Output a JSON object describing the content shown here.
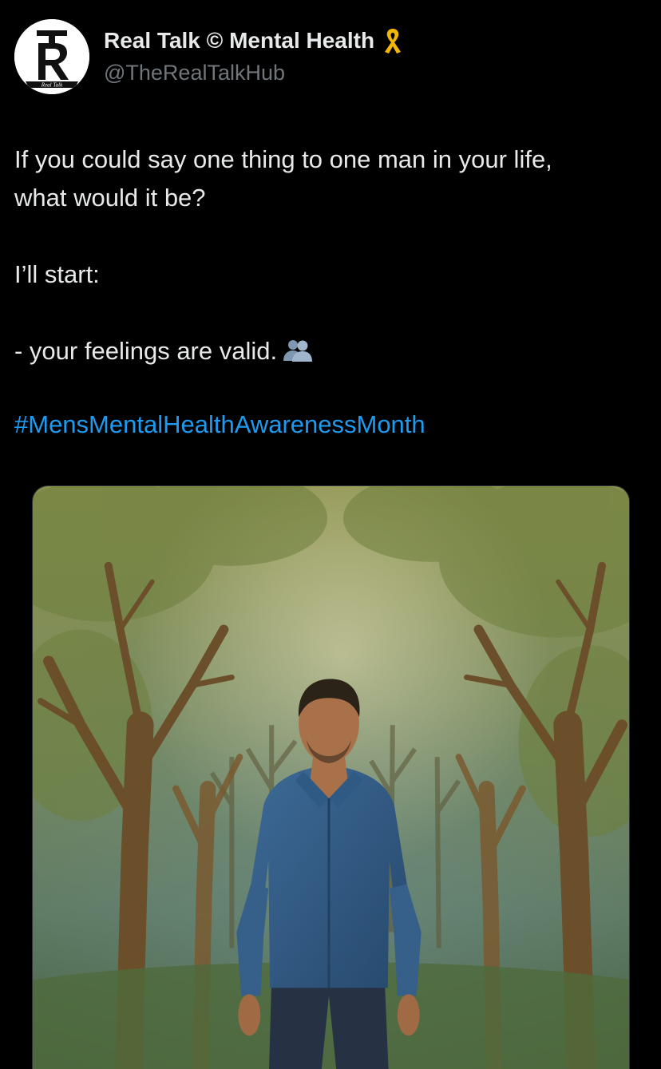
{
  "tweet": {
    "author": {
      "display_name": "Real Talk © Mental Health",
      "handle": "@TheRealTalkHub",
      "avatar_text": "Real Talk",
      "avatar_letters": "TR",
      "badge_icon": "yellow-ribbon-icon",
      "badge_color": "#f2b705"
    },
    "lines": [
      "If you could say one thing to one man in your life,",
      "what would it be?",
      "I’ll start:",
      "- your feelings are valid."
    ],
    "inline_emoji": "busts-in-silhouette-icon",
    "hashtag": "#MensMentalHealthAwarenessMonth",
    "hashtag_color": "#1d9bf0",
    "media": {
      "type": "image",
      "icon": "painting-man-in-forest"
    }
  }
}
